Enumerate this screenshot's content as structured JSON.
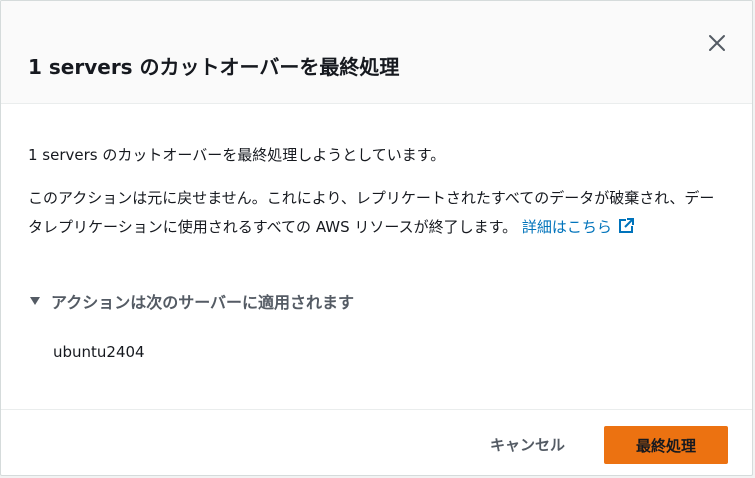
{
  "modal": {
    "title": "1 servers のカットオーバーを最終処理",
    "close_icon": "close-icon"
  },
  "body": {
    "paragraph1": "1 servers のカットオーバーを最終処理しようとしています。",
    "paragraph2": "このアクションは元に戻せません。これにより、レプリケートされたすべてのデータが破棄され、データレプリケーションに使用されるすべての AWS リソースが終了します。",
    "learn_more_link": "詳細はこちら",
    "external_link_icon": "external-link-icon",
    "expandable_header": "アクションは次のサーバーに適用されます",
    "caret_icon": "caret-down-icon",
    "servers": [
      "ubuntu2404"
    ]
  },
  "footer": {
    "cancel_label": "キャンセル",
    "primary_label": "最終処理"
  },
  "colors": {
    "primary_button": "#ec7211",
    "link": "#0073bb",
    "header_bg": "#fafafa"
  }
}
